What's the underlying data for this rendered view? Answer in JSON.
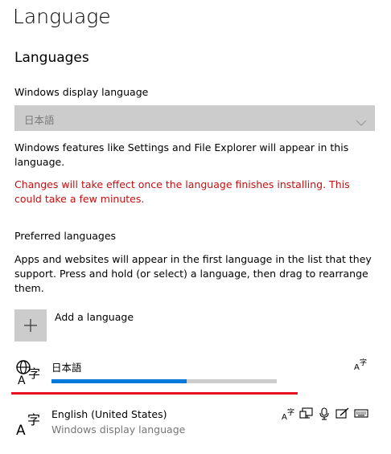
{
  "page": {
    "title": "Language"
  },
  "languages_section": {
    "title": "Languages",
    "display_language_label": "Windows display language",
    "display_language_value": "日本語",
    "info_text": "Windows features like Settings and File Explorer will appear in this language.",
    "warning_text": "Changes will take effect once the language finishes installing. This could take a few minutes."
  },
  "preferred": {
    "label": "Preferred languages",
    "description": "Apps and websites will appear in the first language in the list that they support. Press and hold (or select) a language, then drag to rearrange them.",
    "add_label": "Add a language",
    "items": [
      {
        "name": "日本語",
        "install_progress": 0.6,
        "features": [
          "text-to-speech-icon"
        ]
      },
      {
        "name": "English (United States)",
        "subtitle": "Windows display language",
        "features": [
          "text-to-speech-icon",
          "display-language-icon",
          "speech-icon",
          "handwriting-icon",
          "keyboard-icon"
        ]
      }
    ]
  },
  "colors": {
    "accent": "#0078d7",
    "warning": "#c50f0f",
    "drag_indicator": "#e81123",
    "disabled_fill": "#cccccc"
  }
}
